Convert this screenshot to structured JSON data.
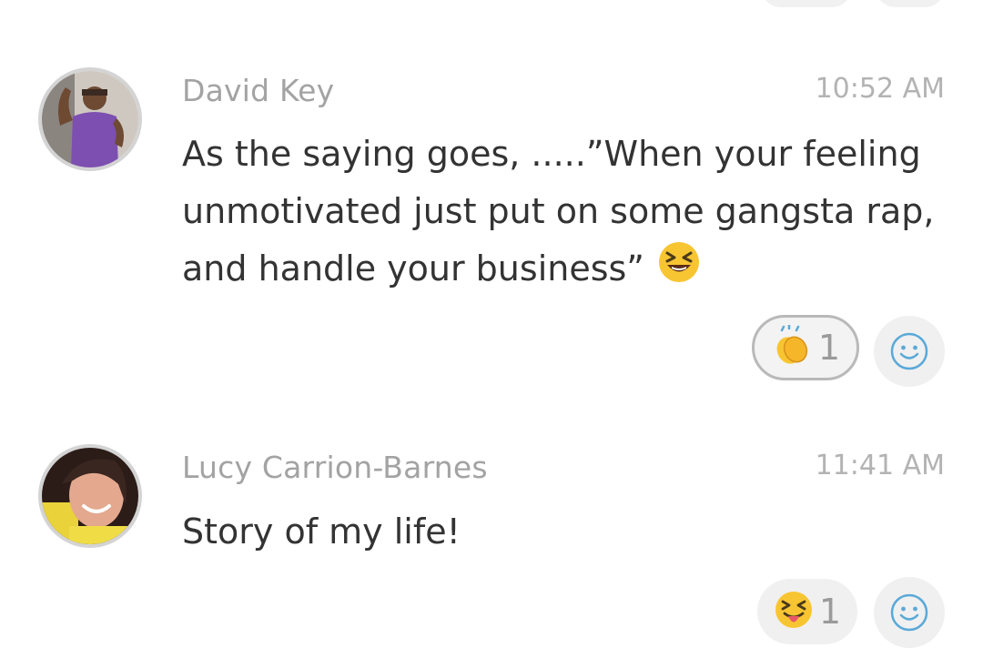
{
  "messages": [
    {
      "author": "David Key",
      "time": "10:52 AM",
      "text": "As the saying goes, .....”When your feeling unmotivated just put on some gangsta rap, and handle your business￼”",
      "text_emoji": "squinting-face-with-tongue-out",
      "reaction": {
        "icon": "clapping-hands",
        "count": "1",
        "selected": true
      }
    },
    {
      "author": "Lucy Carrion-Barnes",
      "time": "11:41 AM",
      "text": "Story of my life!",
      "reaction": {
        "icon": "face-with-tongue",
        "count": "1",
        "selected": false
      }
    }
  ],
  "add_reaction_icon": "smiley-icon",
  "colors": {
    "author": "#a3a3a3",
    "time": "#b3b3b3",
    "text": "#333333",
    "chip": "#f0f0f0",
    "accent": "#5aa9d8"
  }
}
